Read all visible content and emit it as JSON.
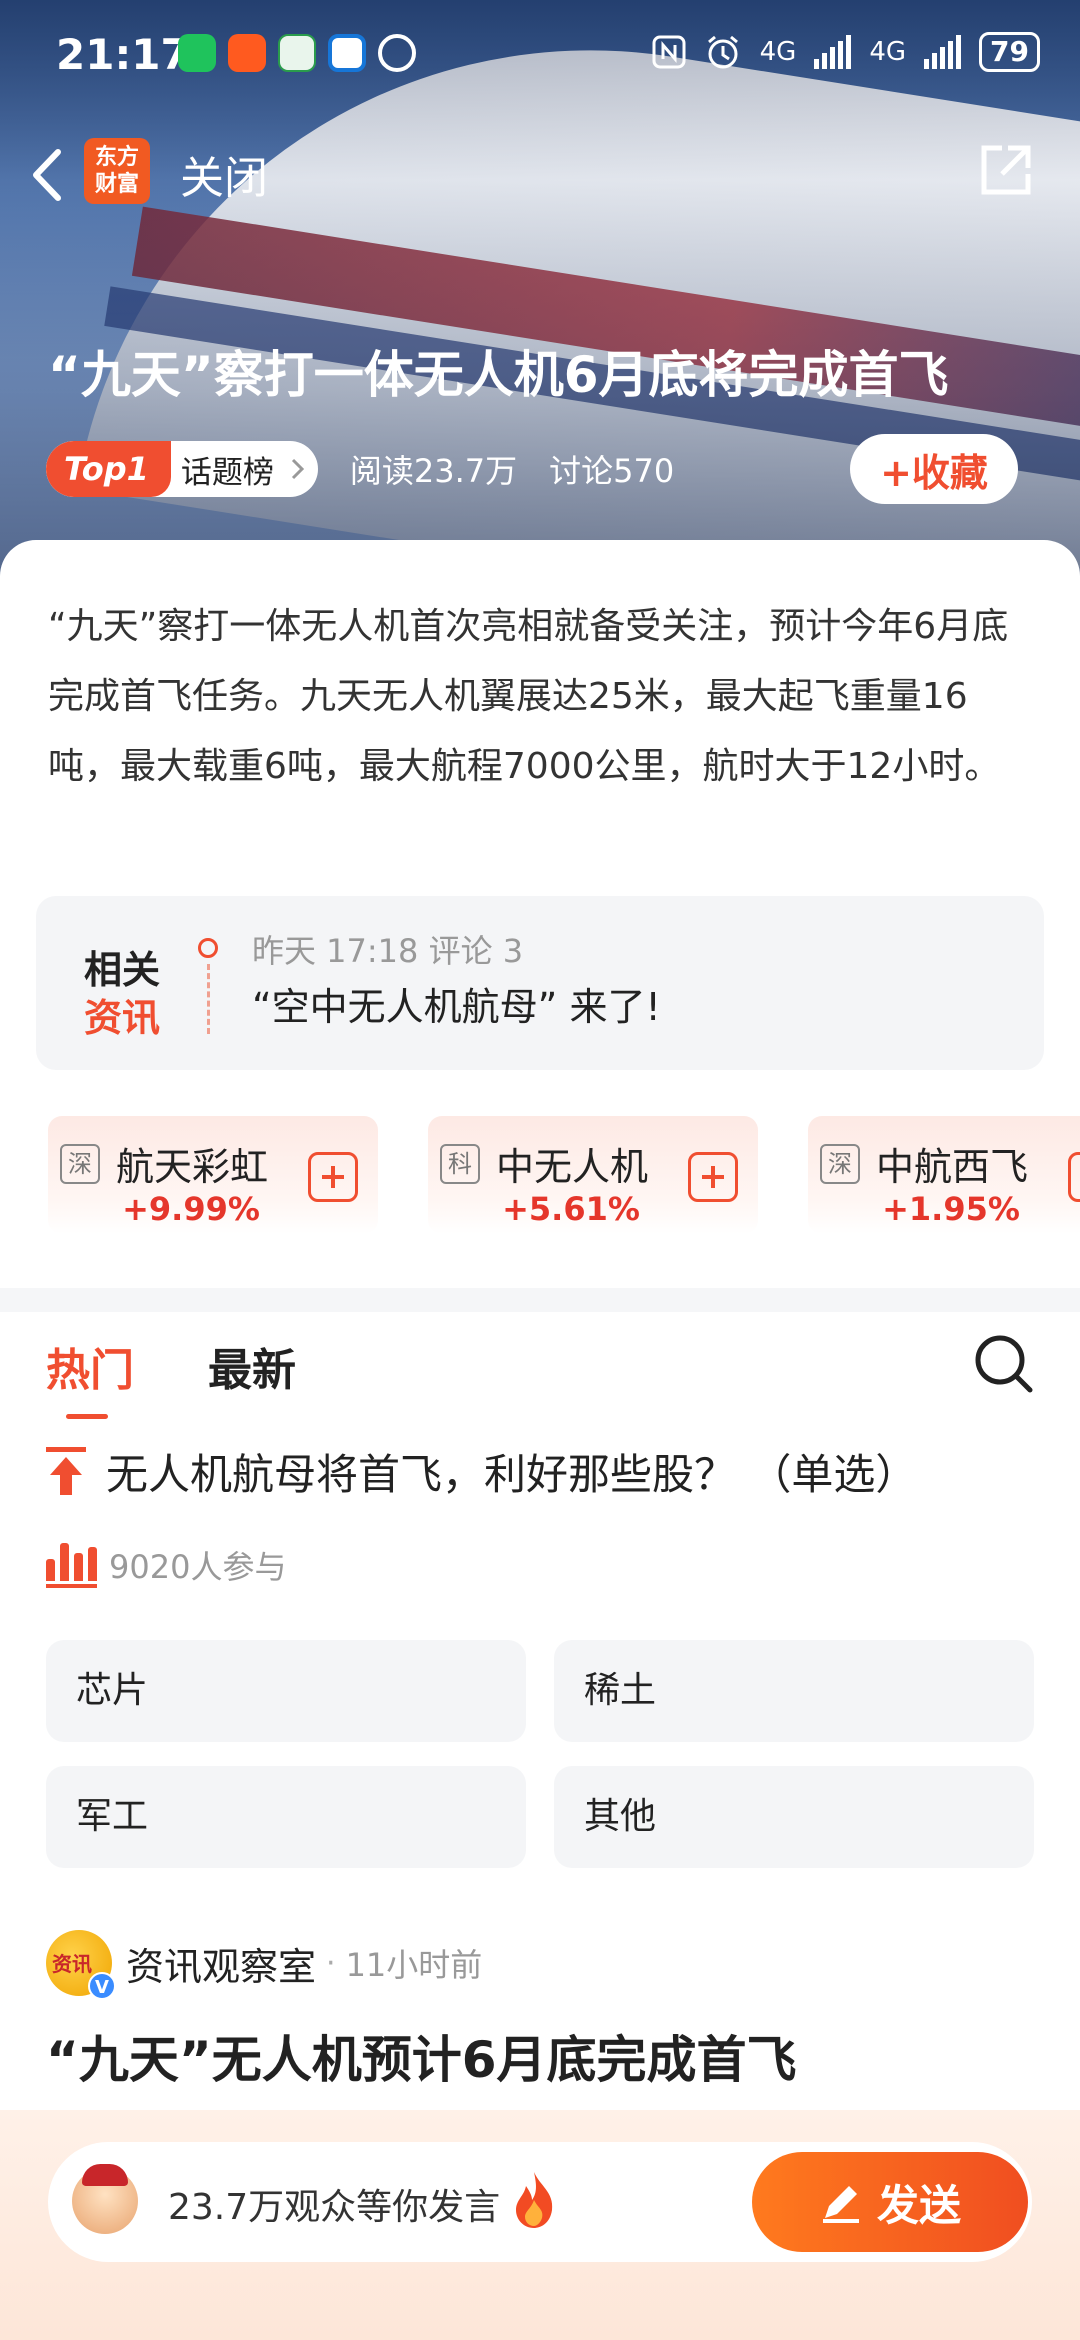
{
  "status_bar": {
    "time": "21:17",
    "network_1": "4G",
    "network_2": "4G",
    "battery": "79"
  },
  "nav": {
    "logo_text_1": "东方",
    "logo_text_2": "财富",
    "close_label": "关闭"
  },
  "topic": {
    "title": "“九天”察打一体无人机6月底将完成首飞",
    "rank_badge": "Top1",
    "rank_list": "话题榜",
    "reads": "阅读23.7万",
    "discussions": "讨论570",
    "favorite_label": "+收藏",
    "summary": "“九天”察打一体无人机首次亮相就备受关注，预计今年6月底完成首飞任务。九天无人机翼展达25米，最大起飞重量16吨，最大载重6吨，最大航程7000公里，航时大于12小时。"
  },
  "related_news": {
    "label_1": "相关",
    "label_2": "资讯",
    "timestamp": "昨天 17:18 评论 3",
    "headline": "“空中无人机航母” 来了!"
  },
  "stocks": [
    {
      "market": "深",
      "name": "航天彩虹",
      "change": "+9.99%"
    },
    {
      "market": "科",
      "name": "中无人机",
      "change": "+5.61%"
    },
    {
      "market": "深",
      "name": "中航西飞",
      "change": "+1.95%"
    }
  ],
  "tabs": {
    "hot": "热门",
    "latest": "最新"
  },
  "poll": {
    "question": "无人机航母将首飞，利好那些股？ （单选）",
    "participants": "9020人参与",
    "options": [
      "芯片",
      "稀土",
      "军工",
      "其他"
    ]
  },
  "post": {
    "author": "资讯观察室",
    "avatar_text": "资讯",
    "separator": "·",
    "time_ago": "11小时前",
    "title": "“九天”无人机预计6月底完成首飞"
  },
  "composer": {
    "placeholder": "23.7万观众等你发言",
    "send_label": "发送"
  },
  "colors": {
    "accent": "#f04e30",
    "stock_up": "#e5362b",
    "send_start": "#ff7a1e",
    "send_end": "#f04e20"
  }
}
